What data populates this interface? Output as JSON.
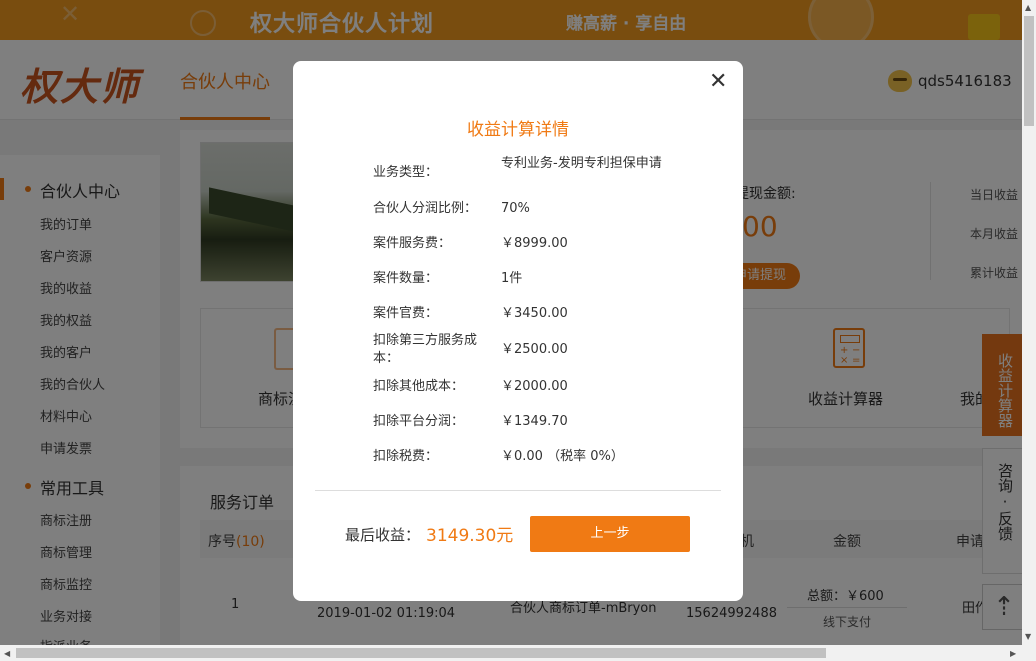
{
  "banner": {
    "title": "权大师合伙人计划",
    "subtitle": "赚高薪 · 享自由"
  },
  "header": {
    "logo": "权大师",
    "nav_active": "合伙人中心",
    "username": "qds5416183"
  },
  "sidebar": {
    "section1": "合伙人中心",
    "items1": [
      "我的订单",
      "客户资源",
      "我的收益",
      "我的权益",
      "我的客户",
      "我的合伙人",
      "材料中心",
      "申请发票"
    ],
    "section2": "常用工具",
    "items2": [
      "商标注册",
      "商标管理",
      "商标监控",
      "业务对接",
      "指派业务"
    ]
  },
  "dashboard": {
    "withdraw_label": "提现金额:",
    "withdraw_amount": "00",
    "withdraw_button": "申请提现",
    "stats": [
      "当日收益",
      "本月收益",
      "累计收益"
    ],
    "tools": [
      "商标注",
      "收益计算器",
      "我的"
    ]
  },
  "orders": {
    "title": "服务订单",
    "headers": {
      "index": "序号",
      "count": "(10)",
      "phone": "机",
      "amount": "金额",
      "applicant": "申请"
    },
    "row": {
      "index": "1",
      "datetime": "2019-01-02 01:19:04",
      "name": "合伙人商标订单-mBryon",
      "phone": "15624992488",
      "total": "总额：￥600",
      "pay": "线下支付",
      "applicant": "田作"
    }
  },
  "float": {
    "calc": "收益计算器",
    "consult": "咨询·反馈",
    "top_icon": "arrow-up-icon"
  },
  "modal": {
    "title": "收益计算详情",
    "rows": [
      {
        "k": "业务类型：",
        "v": "专利业务-发明专利担保申请"
      },
      {
        "k": "合伙人分润比例：",
        "v": "70%"
      },
      {
        "k": "案件服务费：",
        "v": "￥8999.00"
      },
      {
        "k": "案件数量：",
        "v": "1件"
      },
      {
        "k": "案件官费：",
        "v": "￥3450.00"
      },
      {
        "k": "扣除第三方服务成本：",
        "v": "￥2500.00"
      },
      {
        "k": "扣除其他成本：",
        "v": "￥2000.00"
      },
      {
        "k": "扣除平台分润：",
        "v": "￥1349.70"
      },
      {
        "k": "扣除税费：",
        "v": "￥0.00 （税率 0%）"
      }
    ],
    "final_label": "最后收益：",
    "final_value": "3149.30元",
    "prev_button": "上一步",
    "close_icon": "close-icon"
  },
  "colors": {
    "accent": "#f07a14",
    "banner": "#f39a1e"
  }
}
